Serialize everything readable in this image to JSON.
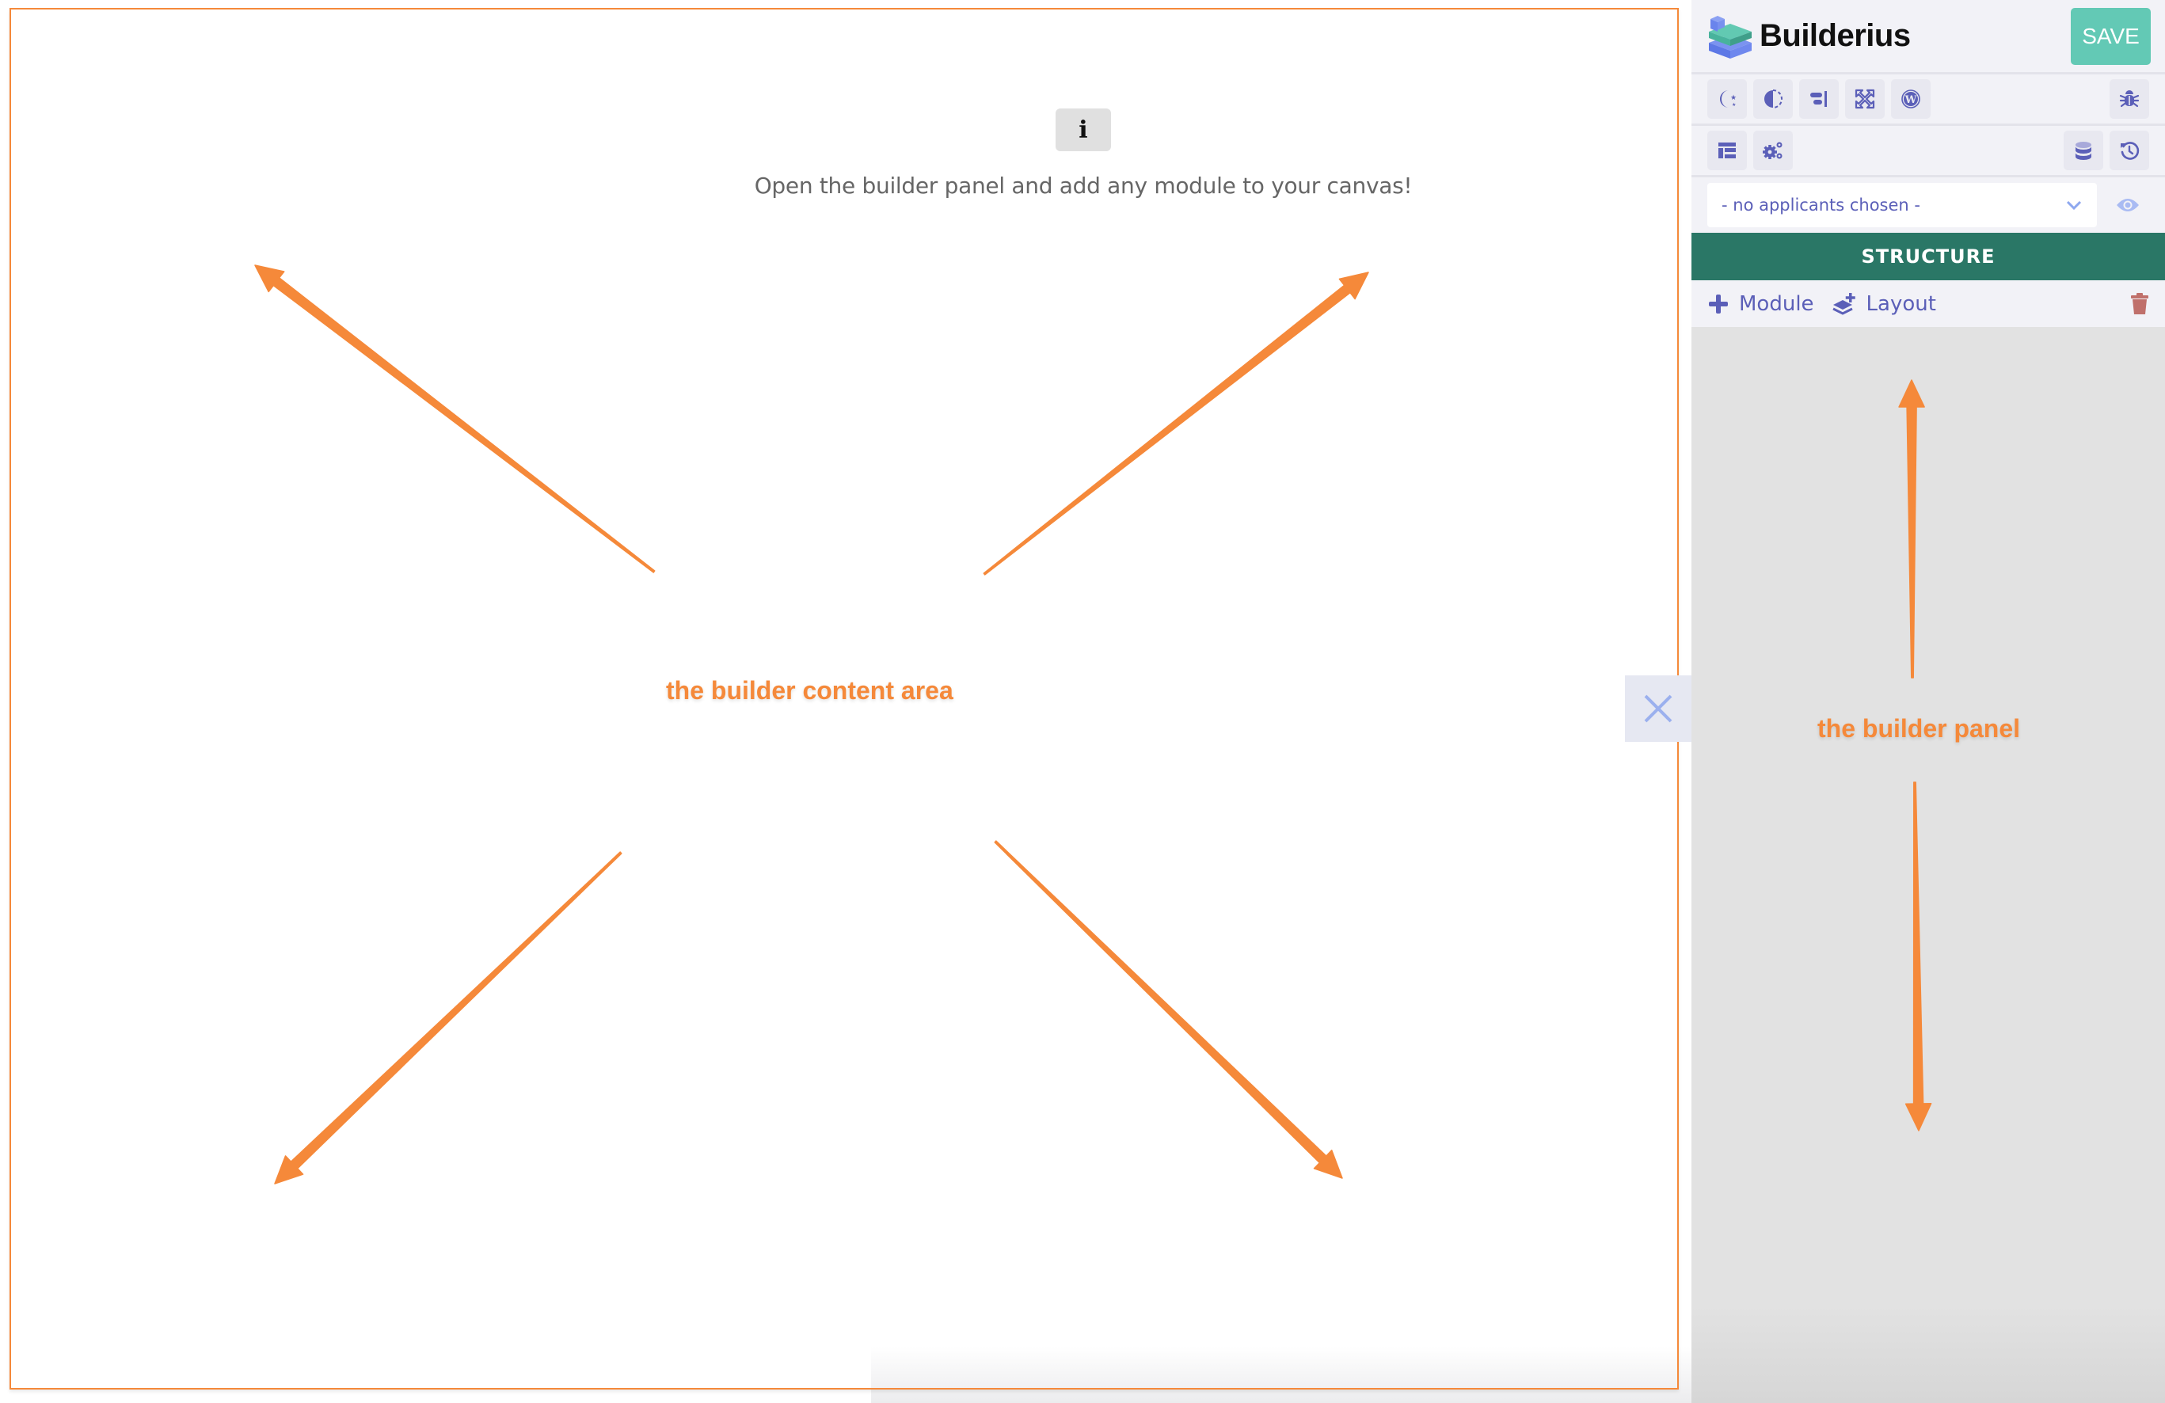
{
  "content_area": {
    "info_badge": "i",
    "empty_message": "Open the builder panel and add any module to your canvas!"
  },
  "annotations": {
    "content_area_label": "the builder content area",
    "panel_label": "the builder panel",
    "accent_color": "#f5893a"
  },
  "panel": {
    "logo_text": "Builderius",
    "save_label": "SAVE",
    "toolbar_row1": {
      "left": [
        "moon-stars-icon",
        "contrast-icon",
        "align-right-icon",
        "expand-arrows-icon",
        "wordpress-icon"
      ],
      "right": [
        "bug-icon"
      ]
    },
    "toolbar_row2": {
      "left": [
        "layout-list-icon",
        "cogs-icon"
      ],
      "right": [
        "database-icon",
        "history-icon"
      ]
    },
    "applicants_select": {
      "value": "- no applicants chosen -"
    },
    "section_title": "STRUCTURE",
    "actions": {
      "module_label": "Module",
      "layout_label": "Layout"
    },
    "colors": {
      "brand_green": "#2a7766",
      "save_green": "#63c9b5",
      "icon_purple": "#5b5fb8",
      "danger": "#c0706b"
    }
  }
}
